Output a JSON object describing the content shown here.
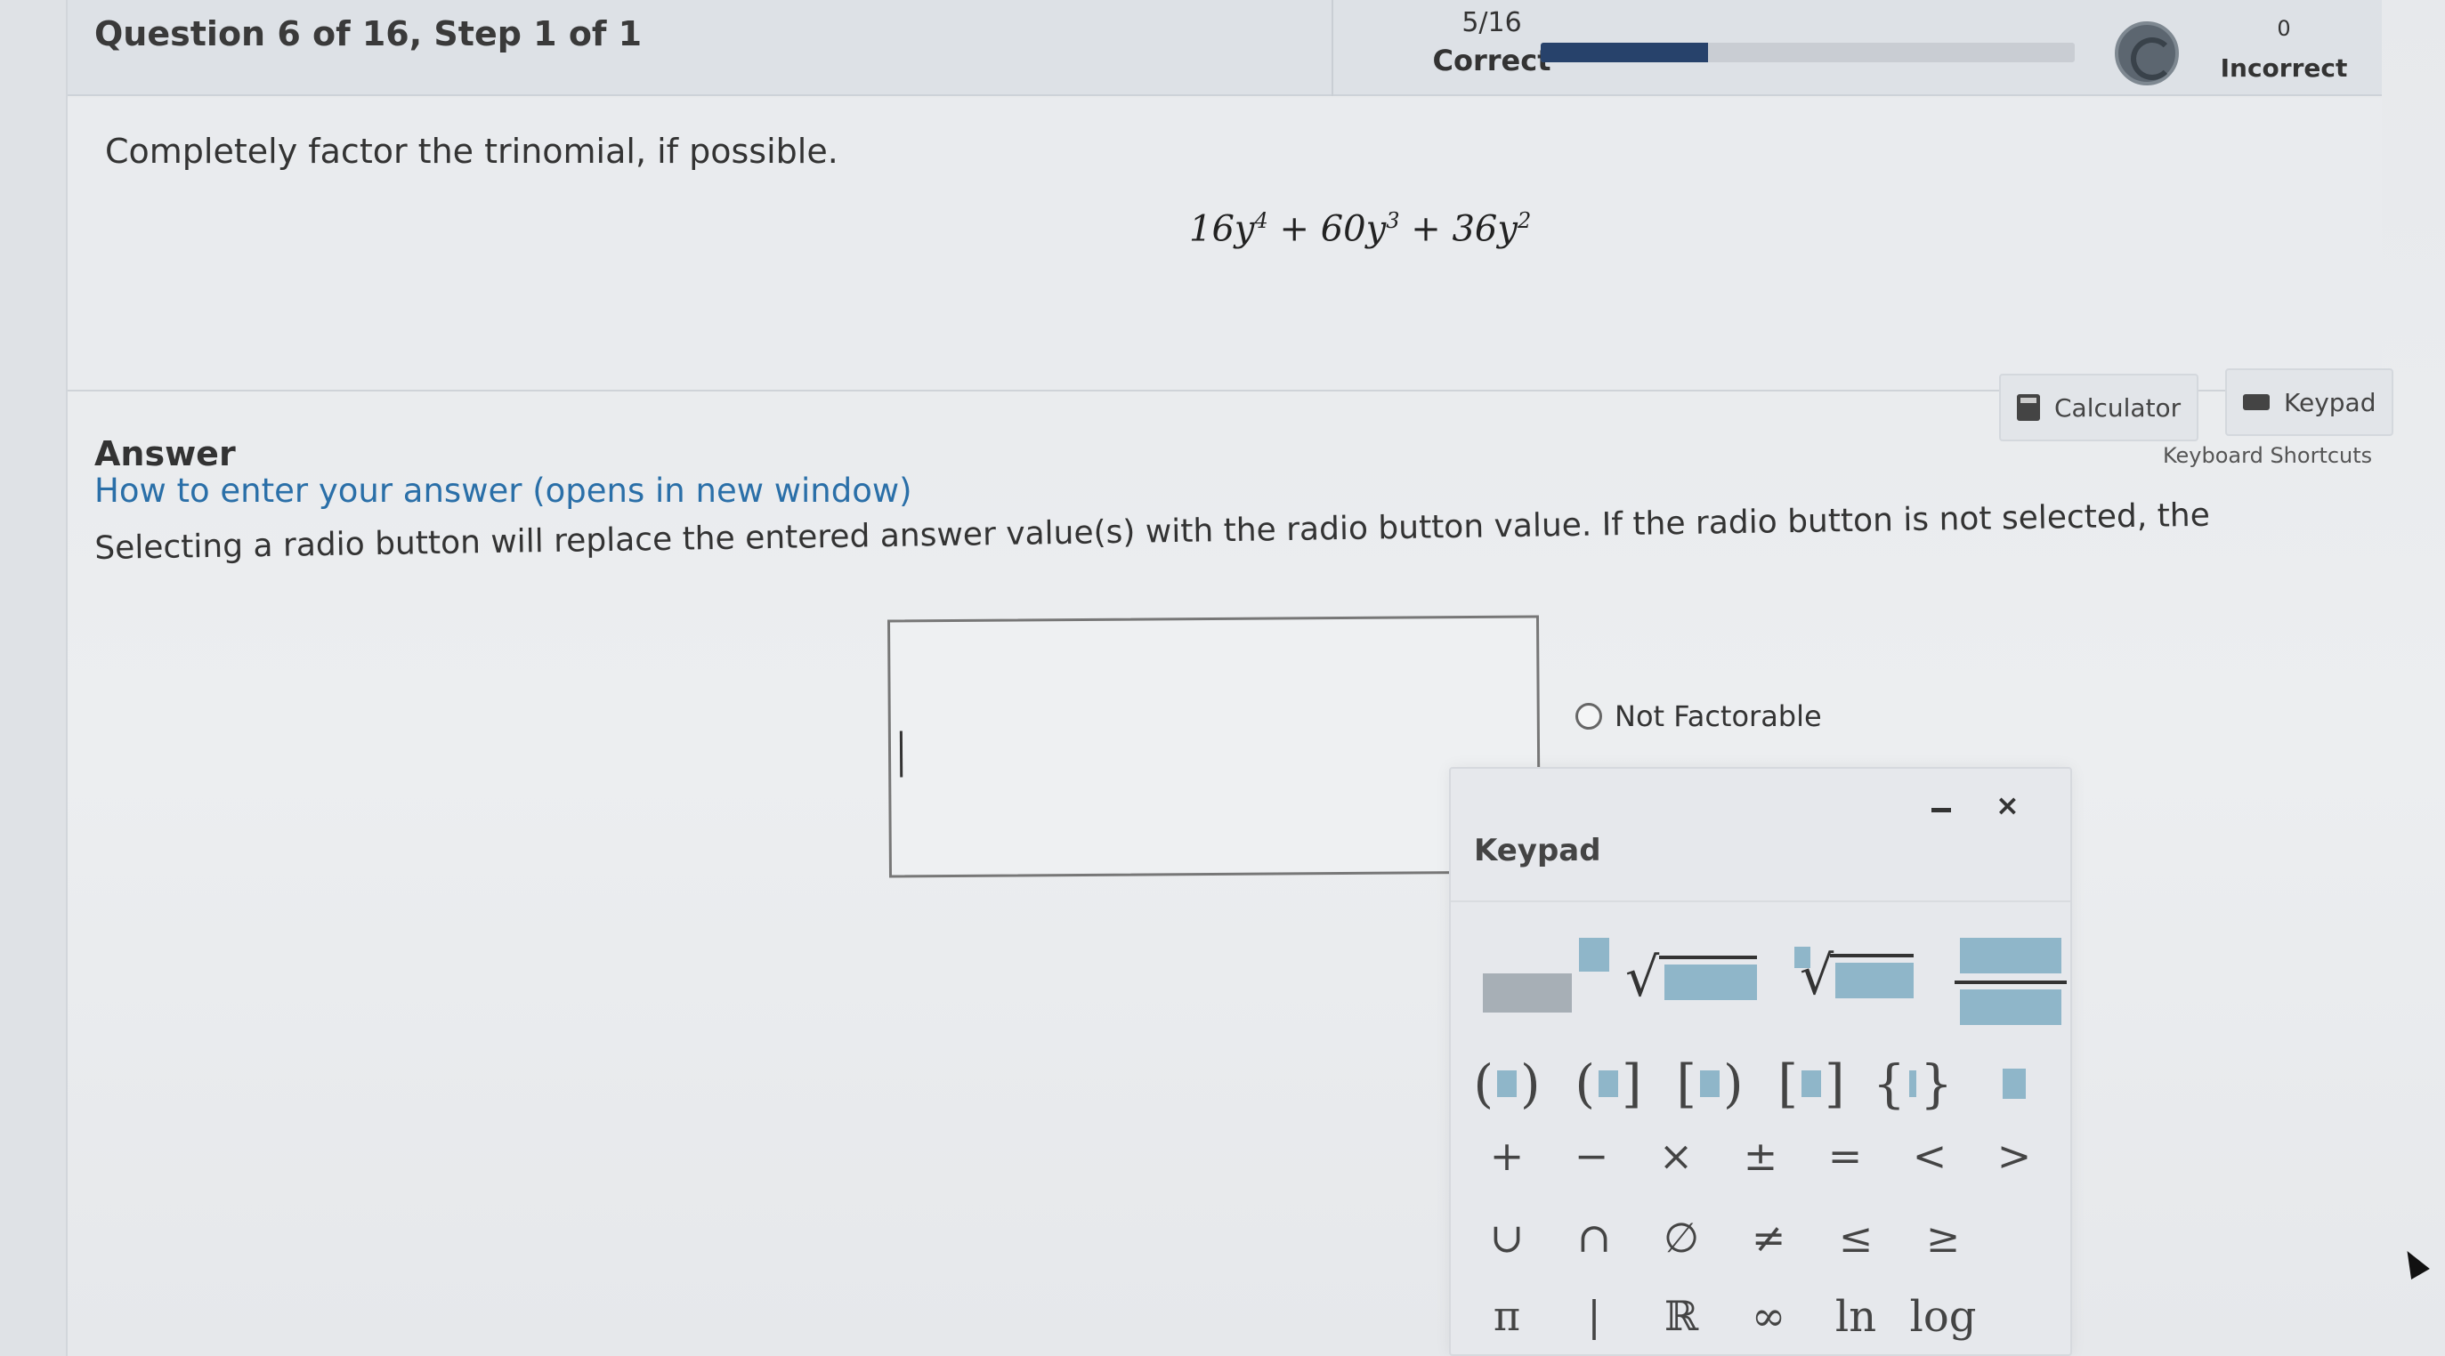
{
  "header": {
    "question_title": "Question 6 of 16,  Step 1 of 1",
    "score_fraction": "5/16",
    "correct_label": "Correct",
    "progress_fraction": 0.3125,
    "incorrect_count": "0",
    "incorrect_label": "Incorrect"
  },
  "question": {
    "prompt": "Completely factor the trinomial, if possible.",
    "expression": {
      "t1": "16y",
      "e1": "4",
      "p1": " + 60y",
      "e2": "3",
      "p2": " + 36y",
      "e3": "2"
    }
  },
  "answer": {
    "title": "Answer",
    "howto_link": "How to enter your answer (opens in new window)",
    "instruction": "Selecting a radio button will replace the entered answer value(s) with the radio button value. If the radio button is not selected, the entered answer is used.",
    "answer_value": "",
    "radio_label": "Not Factorable"
  },
  "tools": {
    "calculator_label": "Calculator",
    "keypad_label": "Keypad",
    "shortcuts_label": "Keyboard Shortcuts"
  },
  "keypad": {
    "title": "Keypad",
    "minimize": "–",
    "close": "×",
    "brackets": [
      {
        "open": "(",
        "close": ")"
      },
      {
        "open": "(",
        "close": "]"
      },
      {
        "open": "[",
        "close": ")"
      },
      {
        "open": "[",
        "close": "]"
      },
      {
        "open": "{",
        "close": "}"
      }
    ],
    "ops": [
      "+",
      "−",
      "×",
      "±",
      "=",
      "<",
      ">"
    ],
    "sets": [
      "∪",
      "∩",
      "∅",
      "≠",
      "≤",
      "≥"
    ],
    "misc": [
      "π",
      "|",
      "ℝ",
      "∞",
      "ln",
      "log"
    ]
  },
  "colors": {
    "progress_fill": "#27426b",
    "link": "#2a6fa8",
    "template_box": "#8fb6c9"
  }
}
